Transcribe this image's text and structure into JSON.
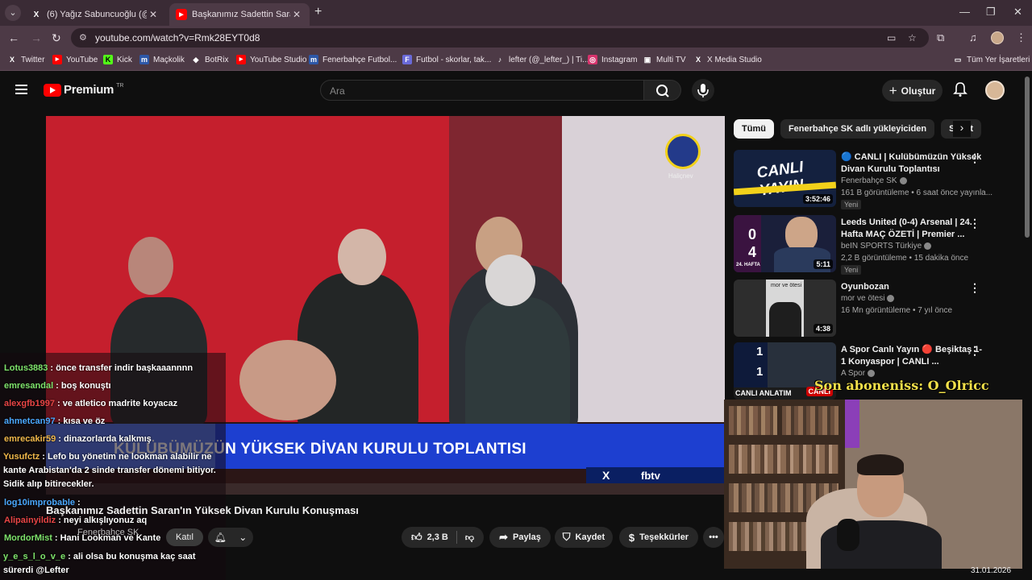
{
  "browser": {
    "tabs": [
      {
        "title": "(6) Yağız Sabuncuoğlu (@yagoş",
        "favicon": "x-icon"
      },
      {
        "title": "Başkanımız Sadettin Saran'ın Yü",
        "favicon": "youtube-icon"
      }
    ],
    "url": "youtube.com/watch?v=Rmk28EYT0d8",
    "bookmarks": [
      {
        "label": "Twitter",
        "icon": "x-icon"
      },
      {
        "label": "YouTube",
        "icon": "youtube-icon"
      },
      {
        "label": "Kick",
        "icon": "kick-icon"
      },
      {
        "label": "Maçkolik",
        "icon": "mackolik-icon"
      },
      {
        "label": "BotRix",
        "icon": "botrix-icon"
      },
      {
        "label": "YouTube Studio",
        "icon": "youtube-icon"
      },
      {
        "label": "Fenerbahçe Futbol...",
        "icon": "fb-icon"
      },
      {
        "label": "Futbol - skorlar, tak...",
        "icon": "futbol-icon"
      },
      {
        "label": "lefter (@_lefter_) | Ti...",
        "icon": "tiktok-icon"
      },
      {
        "label": "Instagram",
        "icon": "instagram-icon"
      },
      {
        "label": "Multi TV",
        "icon": "tv-icon"
      },
      {
        "label": "X Media Studio",
        "icon": "x-icon"
      }
    ],
    "all_bookmarks": "Tüm Yer İşaretleri"
  },
  "youtube": {
    "logo": "Premium",
    "country": "TR",
    "search_placeholder": "Ara",
    "create": "Oluştur"
  },
  "video": {
    "banner": "KULÜBÜMÜZÜN YÜKSEK DİVAN KURULU TOPLANTISI",
    "network": "fbtv",
    "logo_caption": "Haliçnev",
    "title": "Başkanımız Sadettin Saran'ın Yüksek Divan Kurulu Konuşması",
    "channel": "Fenerbahçe SK",
    "join": "Katıl",
    "likes": "2,3 B",
    "share": "Paylaş",
    "save": "Kaydet",
    "thanks": "Teşekkürler",
    "date": "31.01.2026"
  },
  "chat": [
    {
      "user": "Lotus3883",
      "color": "#7ee36b",
      "text": ": önce transfer indir başkaaannnn"
    },
    {
      "user": "emresandal",
      "color": "#7ee36b",
      "text": ": boş konuştı"
    },
    {
      "user": "alexgfb1997",
      "color": "#e84545",
      "text": ": ve atletico madrite koyacaz"
    },
    {
      "user": "ahmetcan97",
      "color": "#4aa8ff",
      "text": ": kısa ve öz"
    },
    {
      "user": "emrecakir59",
      "color": "#f0b84a",
      "text": ": dinazorlarda kalkmış"
    },
    {
      "user": "Yusufctz",
      "color": "#f0b84a",
      "text": ": Lefo bu yönetim ne lookman alabilir ne kante Arabistan'da 2 sinde transfer dönemi bitiyor. Sidik alıp bitirecekler."
    },
    {
      "user": "log10improbable",
      "color": "#4aa8ff",
      "text": ":"
    },
    {
      "user": "Alipainyildiz",
      "color": "#e84545",
      "text": ": neyi alkışlıyonuz aq"
    },
    {
      "user": "MordorMist",
      "color": "#7ee36b",
      "text": ": Hani Lookman ve Kante"
    },
    {
      "user": "y_e_s_l_o_v_e",
      "color": "#7ee36b",
      "text": ": ali olsa bu konuşma kaç saat sürerdi @Lefter"
    }
  ],
  "chips": [
    "Tümü",
    "Fenerbahçe SK adlı yükleyiciden",
    "Sadet"
  ],
  "recommendations": [
    {
      "title": "🔵 CANLI | Kulübümüzün Yüksek Divan Kurulu Toplantısı",
      "channel": "Fenerbahçe SK",
      "meta": "161 B görüntüleme • 6 saat önce yayınla...",
      "badge": "Yeni",
      "duration": "3:52:46",
      "thumb_label": "CANLI YAYIN"
    },
    {
      "title": "Leeds United (0-4) Arsenal | 24. Hafta MAÇ ÖZETİ | Premier ...",
      "channel": "beIN SPORTS Türkiye",
      "meta": "2,2 B görüntüleme • 15 dakika önce",
      "badge": "Yeni",
      "duration": "5:11",
      "thumb_label": "24. HAFTA"
    },
    {
      "title": "Oyunbozan",
      "channel": "mor ve ötesi",
      "meta": "16 Mn görüntüleme • 7 yıl önce",
      "badge": "",
      "duration": "4:38",
      "thumb_label": "mor ve ötesi"
    },
    {
      "title": "A Spor Canlı Yayın 🔴 Beşiktaş 1-1 Konyaspor | CANLI ...",
      "channel": "A Spor",
      "meta": "",
      "badge": "",
      "duration": "CANLI",
      "thumb_label": "CANLI ANLATIM"
    }
  ],
  "stream_overlay": {
    "last_sub": "Son aboneniss: O_Olricc"
  },
  "colors": {
    "youtube_red": "#ff0000",
    "banner_blue": "#1d3fd0",
    "overlay_yellow": "#f2e04a"
  }
}
